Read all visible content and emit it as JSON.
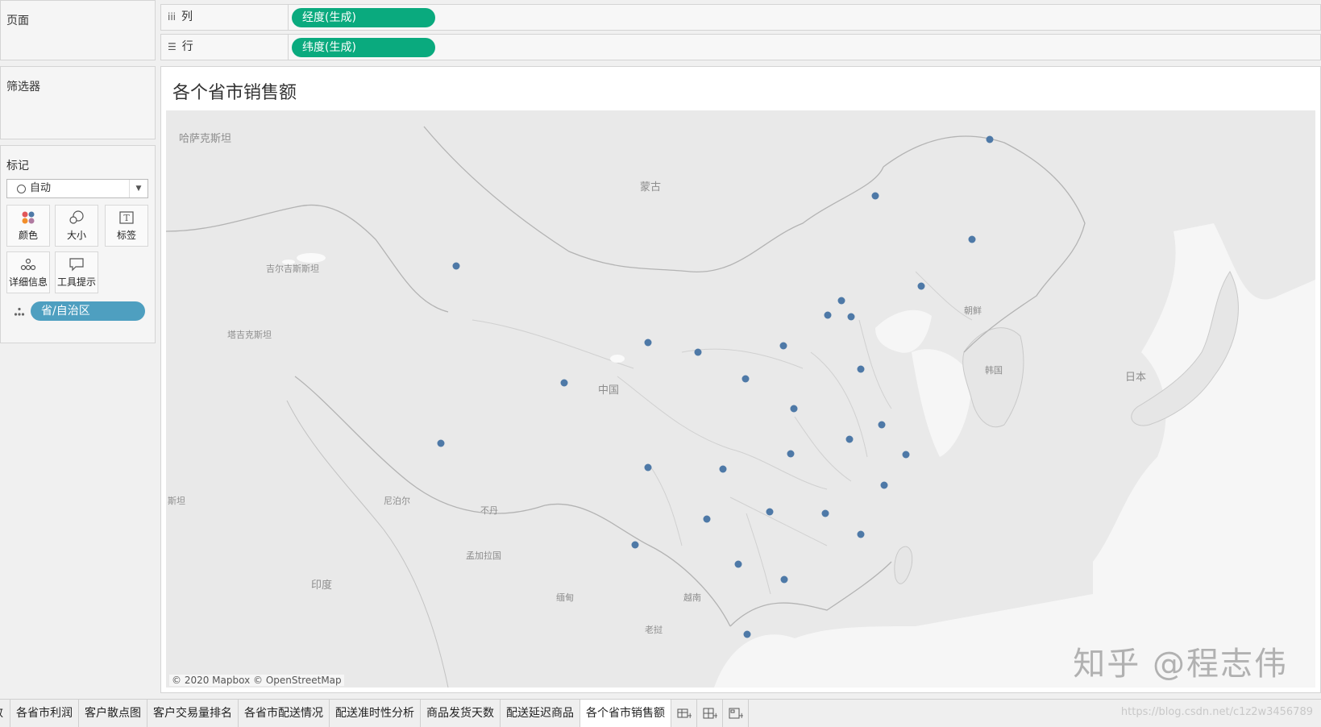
{
  "sidebar": {
    "pages_title": "页面",
    "filters_title": "筛选器",
    "marks_title": "标记",
    "mark_type": "自动",
    "mark_buttons": [
      {
        "label": "颜色",
        "icon": "color-icon"
      },
      {
        "label": "大小",
        "icon": "size-icon"
      },
      {
        "label": "标签",
        "icon": "label-icon"
      },
      {
        "label": "详细信息",
        "icon": "detail-icon"
      },
      {
        "label": "工具提示",
        "icon": "tooltip-icon"
      }
    ],
    "detail_field": "省/自治区"
  },
  "shelves": {
    "columns_label": "列",
    "columns_pill": "经度(生成)",
    "rows_label": "行",
    "rows_pill": "纬度(生成)"
  },
  "viz": {
    "title": "各个省市销售额",
    "attribution": "© 2020 Mapbox © OpenStreetMap",
    "watermark": "知乎 @程志伟",
    "map_labels": [
      "哈萨克斯坦",
      "蒙古",
      "吉尔吉斯斯坦",
      "塔吉克斯坦",
      "中国",
      "朝鲜",
      "韩国",
      "日本",
      "尼泊尔",
      "不丹",
      "孟加拉国",
      "印度",
      "缅甸",
      "老挝",
      "越南",
      "斯坦"
    ],
    "point_color": "#4e79a7"
  },
  "tabs": {
    "items": [
      "数",
      "各省市利润",
      "客户散点图",
      "客户交易量排名",
      "各省市配送情况",
      "配送准时性分析",
      "商品发货天数",
      "配送延迟商品",
      "各个省市销售额"
    ],
    "active": "各个省市销售额",
    "url_watermark": "https://blog.csdn.net/c1z2w3456789"
  }
}
